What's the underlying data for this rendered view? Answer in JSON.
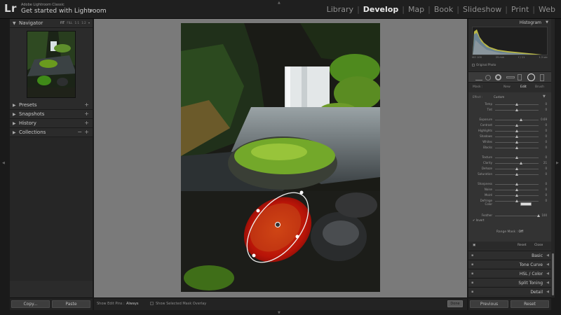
{
  "app": {
    "logo": "Lr",
    "subtitle": "Adobe Lightroom Classic",
    "title": "Get started with Lightroom"
  },
  "modules": [
    "Library",
    "Develop",
    "Map",
    "Book",
    "Slideshow",
    "Print",
    "Web"
  ],
  "active_module": "Develop",
  "left_panel": {
    "navigator": {
      "label": "Navigator",
      "zoom_options": [
        "FIT",
        "FILL",
        "1:1",
        "1:2",
        "▾"
      ],
      "active_zoom": "FIT"
    },
    "sections": [
      {
        "label": "Presets",
        "has_minus": false
      },
      {
        "label": "Snapshots",
        "has_minus": false
      },
      {
        "label": "History",
        "has_minus": false
      },
      {
        "label": "Collections",
        "has_minus": true
      }
    ],
    "copy_button": "Copy...",
    "paste_button": "Paste"
  },
  "toolbar": {
    "show_edit_pins_label": "Show Edit Pins :",
    "show_edit_pins_value": "Always",
    "overlay_label": "Show Selected Mask Overlay",
    "done_button": "Done"
  },
  "right_panel": {
    "histogram": {
      "label": "Histogram",
      "info": [
        "ISO 100",
        "25 mm",
        "f / 11",
        "1.3 sec"
      ],
      "original_photo": "Original Photo"
    },
    "mask": {
      "label": "Mask :",
      "options": [
        "New",
        "Edit",
        "Brush"
      ],
      "active": "Edit"
    },
    "effect": {
      "label": "Effect :",
      "value": "Custom"
    },
    "sliders": [
      {
        "name": "Temp",
        "value": "0",
        "pos": 0.5
      },
      {
        "name": "Tint",
        "value": "0",
        "pos": 0.5
      },
      {
        "name": "Exposure",
        "value": "0.69",
        "pos": 0.6
      },
      {
        "name": "Contrast",
        "value": "0",
        "pos": 0.5
      },
      {
        "name": "Highlights",
        "value": "0",
        "pos": 0.5
      },
      {
        "name": "Shadows",
        "value": "0",
        "pos": 0.5
      },
      {
        "name": "Whites",
        "value": "0",
        "pos": 0.5
      },
      {
        "name": "Blacks",
        "value": "0",
        "pos": 0.5
      },
      {
        "name": "Texture",
        "value": "0",
        "pos": 0.5
      },
      {
        "name": "Clarity",
        "value": "21",
        "pos": 0.6
      },
      {
        "name": "Dehaze",
        "value": "0",
        "pos": 0.5
      },
      {
        "name": "Saturation",
        "value": "0",
        "pos": 0.5
      },
      {
        "name": "Sharpness",
        "value": "0",
        "pos": 0.5
      },
      {
        "name": "Noise",
        "value": "0",
        "pos": 0.5
      },
      {
        "name": "Moiré",
        "value": "0",
        "pos": 0.5
      },
      {
        "name": "Defringe",
        "value": "0",
        "pos": 0.5
      }
    ],
    "color_label": "Color",
    "feather": {
      "label": "Feather",
      "value": "100",
      "pos": 1.0
    },
    "invert_label": "Invert",
    "range_mask": {
      "label": "Range Mask :",
      "value": "Off"
    },
    "reset_label": "Reset",
    "close_label": "Close",
    "sections": [
      "Basic",
      "Tone Curve",
      "HSL / Color",
      "Split Toning",
      "Detail"
    ],
    "previous_button": "Previous",
    "reset_button": "Reset"
  },
  "colors": {
    "panel": "#2b2b2b",
    "canvas": "#7a7a7a",
    "mask_overlay": "#d01010"
  }
}
